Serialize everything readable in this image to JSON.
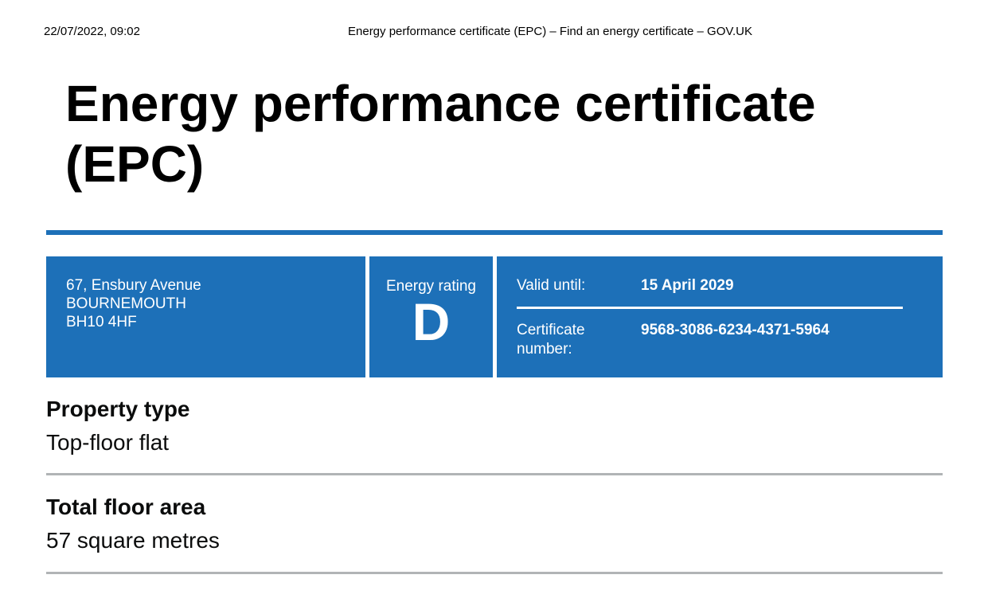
{
  "print_header": {
    "datetime": "22/07/2022, 09:02",
    "page_title": "Energy performance certificate (EPC) – Find an energy certificate – GOV.UK"
  },
  "title": "Energy performance certificate (EPC)",
  "summary": {
    "address": {
      "line1": "67, Ensbury Avenue",
      "line2": "BOURNEMOUTH",
      "line3": "BH10 4HF"
    },
    "rating": {
      "label": "Energy rating",
      "value": "D"
    },
    "valid_until": {
      "label": "Valid until:",
      "value": "15 April 2029"
    },
    "certificate_number": {
      "label": "Certificate number:",
      "value": "9568-3086-6234-4371-5964"
    }
  },
  "sections": {
    "property_type": {
      "heading": "Property type",
      "value": "Top-floor flat"
    },
    "floor_area": {
      "heading": "Total floor area",
      "value": "57 square metres"
    }
  },
  "colors": {
    "brand_blue": "#1d70b8",
    "divider_grey": "#b1b4b6"
  }
}
